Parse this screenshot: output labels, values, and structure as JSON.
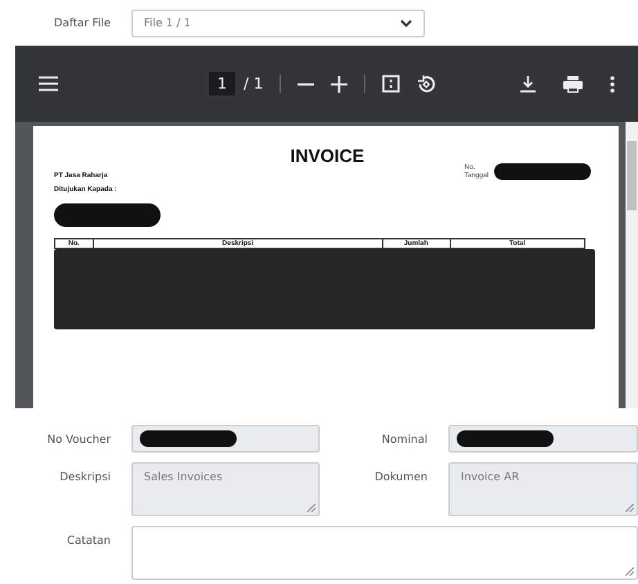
{
  "file_select": {
    "label": "Daftar File",
    "value": "File 1 / 1"
  },
  "viewer": {
    "page_input": "1",
    "page_total": "/ 1",
    "document": {
      "title": "INVOICE",
      "company": "PT Jasa Raharja",
      "meta_labels": [
        "No.",
        "Tanggal"
      ],
      "meta_redacted": true,
      "recipient_label": "Ditujukan Kapada :",
      "recipient_redacted": true,
      "table_columns": [
        "No.",
        "Deskripsi",
        "Jumlah",
        "Total"
      ],
      "table_redacted": true
    }
  },
  "form": {
    "rows": [
      [
        {
          "label": "No Voucher",
          "kind": "input",
          "disabled": true,
          "redacted": true
        },
        {
          "label": "Nominal",
          "kind": "input",
          "disabled": true,
          "redacted": true
        }
      ],
      [
        {
          "label": "Deskripsi",
          "kind": "textarea",
          "disabled": true,
          "redacted": false,
          "value": "Sales Invoices"
        },
        {
          "label": "Dokumen",
          "kind": "textarea",
          "disabled": true,
          "redacted": false,
          "value": "Invoice AR"
        }
      ],
      [
        {
          "label": "Catatan",
          "kind": "textarea",
          "disabled": false,
          "redacted": false
        }
      ]
    ]
  }
}
